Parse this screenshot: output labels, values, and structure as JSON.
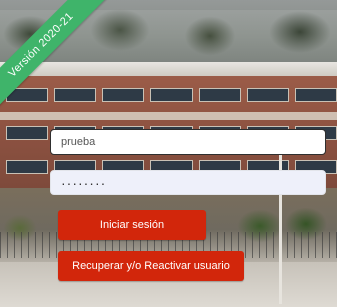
{
  "ribbon": {
    "text": "Versión 2020-21",
    "color": "#3fb46a"
  },
  "login_form": {
    "username": {
      "value": "prueba"
    },
    "password": {
      "value": "········"
    },
    "login_button_label": "Iniciar sesión",
    "recover_button_label": "Recuperar y/o Reactivar usuario",
    "button_color": "#d2260b"
  }
}
